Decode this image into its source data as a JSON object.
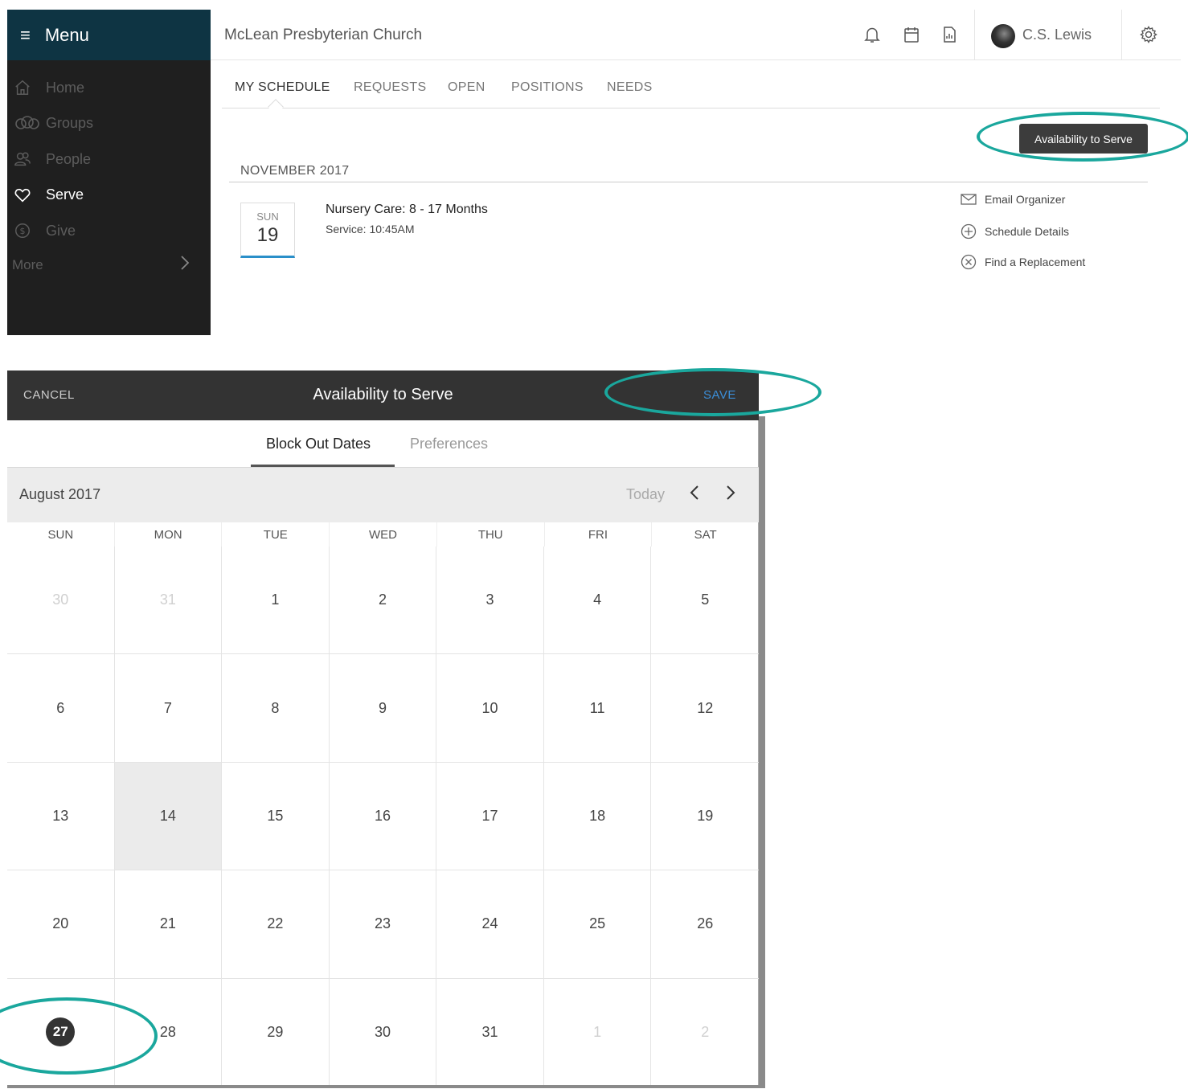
{
  "sidebar": {
    "menu_label": "Menu",
    "items": [
      {
        "label": "Home",
        "icon": "home-icon"
      },
      {
        "label": "Groups",
        "icon": "groups-icon"
      },
      {
        "label": "People",
        "icon": "people-icon"
      },
      {
        "label": "Serve",
        "icon": "heart-icon",
        "active": true
      },
      {
        "label": "Give",
        "icon": "dollar-icon"
      }
    ],
    "more_label": "More"
  },
  "topbar": {
    "org_name": "McLean Presbyterian Church",
    "user_name": "C.S. Lewis"
  },
  "tabs": [
    "MY SCHEDULE",
    "REQUESTS",
    "OPEN",
    "POSITIONS",
    "NEEDS"
  ],
  "availability_button": "Availability to Serve",
  "schedule": {
    "month": "NOVEMBER 2017",
    "event": {
      "dow": "SUN",
      "day": "19",
      "title": "Nursery Care: 8 - 17 Months",
      "subtitle": "Service: 10:45AM"
    },
    "actions": [
      "Email Organizer",
      "Schedule Details",
      "Find a Replacement"
    ]
  },
  "modal": {
    "cancel": "CANCEL",
    "title": "Availability to Serve",
    "save": "SAVE",
    "tab_block": "Block Out Dates",
    "tab_prefs": "Preferences",
    "month": "August 2017",
    "today": "Today",
    "weekdays": [
      "SUN",
      "MON",
      "TUE",
      "WED",
      "THU",
      "FRI",
      "SAT"
    ],
    "weeks": [
      [
        "30",
        "31",
        "1",
        "2",
        "3",
        "4",
        "5"
      ],
      [
        "6",
        "7",
        "8",
        "9",
        "10",
        "11",
        "12"
      ],
      [
        "13",
        "14",
        "15",
        "16",
        "17",
        "18",
        "19"
      ],
      [
        "20",
        "21",
        "22",
        "23",
        "24",
        "25",
        "26"
      ],
      [
        "27",
        "28",
        "29",
        "30",
        "31",
        "1",
        "2"
      ]
    ],
    "muted": [
      [
        0,
        0
      ],
      [
        0,
        1
      ],
      [
        4,
        5
      ],
      [
        4,
        6
      ]
    ],
    "highlighted": [
      2,
      1
    ],
    "selected": [
      4,
      0
    ]
  },
  "colors": {
    "accent_ring": "#1aa79d",
    "save_blue": "#3b8ed8",
    "menu_header": "#0e3443"
  }
}
